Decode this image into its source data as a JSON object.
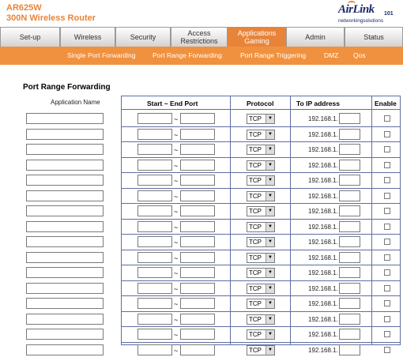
{
  "header": {
    "model": "AR625W",
    "subtitle": "300N Wireless Router",
    "logo_text": "AirLink",
    "logo_number": "101",
    "logo_tagline": "networkingsolutions"
  },
  "tabs": [
    {
      "label": "Set-up",
      "active": false
    },
    {
      "label": "Wireless",
      "active": false
    },
    {
      "label": "Security",
      "active": false
    },
    {
      "label": "Access Restrictions",
      "active": false
    },
    {
      "label": "Applications Gaming",
      "active": true
    },
    {
      "label": "Admin",
      "active": false
    },
    {
      "label": "Status",
      "active": false
    }
  ],
  "subnav": [
    {
      "label": "Single Port Forwarding"
    },
    {
      "label": "Port Range Forwarding"
    },
    {
      "label": "Port Range Triggering"
    },
    {
      "label": "DMZ"
    },
    {
      "label": "Qos"
    }
  ],
  "section_title": "Port Range Forwarding",
  "columns": {
    "application_name": "Application Name",
    "port_range": "Start ~ End Port",
    "protocol": "Protocol",
    "ip_address": "To IP address",
    "enable": "Enable"
  },
  "rows": [
    {
      "tilde": "~",
      "protocol": "TCP",
      "ip_prefix": "192.168.1.",
      "enabled": false
    },
    {
      "tilde": "~",
      "protocol": "TCP",
      "ip_prefix": "192.168.1.",
      "enabled": false
    },
    {
      "tilde": "~",
      "protocol": "TCP",
      "ip_prefix": "192.168.1.",
      "enabled": false
    },
    {
      "tilde": "~",
      "protocol": "TCP",
      "ip_prefix": "192.168.1.",
      "enabled": false
    },
    {
      "tilde": "~",
      "protocol": "TCP",
      "ip_prefix": "192.168.1.",
      "enabled": false
    },
    {
      "tilde": "~",
      "protocol": "TCP",
      "ip_prefix": "192.168.1.",
      "enabled": false
    },
    {
      "tilde": "~",
      "protocol": "TCP",
      "ip_prefix": "192.168.1.",
      "enabled": false
    },
    {
      "tilde": "~",
      "protocol": "TCP",
      "ip_prefix": "192.168.1.",
      "enabled": false
    },
    {
      "tilde": "~",
      "protocol": "TCP",
      "ip_prefix": "192.168.1.",
      "enabled": false
    },
    {
      "tilde": "~",
      "protocol": "TCP",
      "ip_prefix": "192.168.1.",
      "enabled": false
    },
    {
      "tilde": "~",
      "protocol": "TCP",
      "ip_prefix": "192.168.1.",
      "enabled": false
    },
    {
      "tilde": "~",
      "protocol": "TCP",
      "ip_prefix": "192.168.1.",
      "enabled": false
    },
    {
      "tilde": "~",
      "protocol": "TCP",
      "ip_prefix": "192.168.1.",
      "enabled": false
    },
    {
      "tilde": "~",
      "protocol": "TCP",
      "ip_prefix": "192.168.1.",
      "enabled": false
    },
    {
      "tilde": "~",
      "protocol": "TCP",
      "ip_prefix": "192.168.1.",
      "enabled": false
    },
    {
      "tilde": "~",
      "protocol": "TCP",
      "ip_prefix": "192.168.1.",
      "enabled": false
    }
  ],
  "colors": {
    "accent": "#e8843a",
    "subnav": "#f0913f",
    "grid_border": "#5f6e9f",
    "logo": "#1a2b6b"
  }
}
